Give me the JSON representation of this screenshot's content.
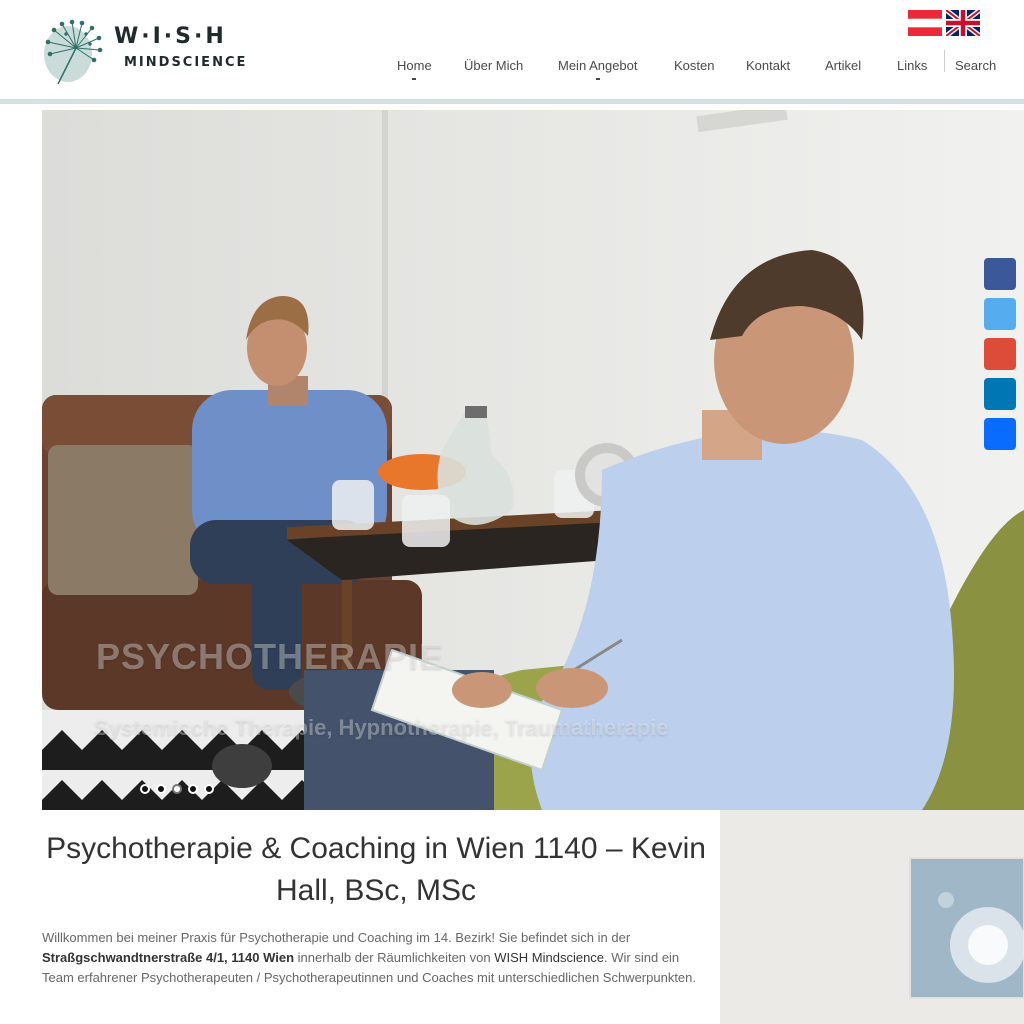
{
  "brand": {
    "name": "W·I·S·H",
    "tagline": "MINDSCIENCE"
  },
  "languages": [
    {
      "code": "de-AT",
      "icon": "austria-flag-icon"
    },
    {
      "code": "en-GB",
      "icon": "uk-flag-icon"
    }
  ],
  "nav": {
    "items": [
      {
        "label": "Home"
      },
      {
        "label": "Über Mich"
      },
      {
        "label": "Mein Angebot"
      },
      {
        "label": "Kosten"
      },
      {
        "label": "Kontakt"
      },
      {
        "label": "Artikel"
      },
      {
        "label": "Links"
      }
    ],
    "search_label": "Search"
  },
  "slider": {
    "title": "PSYCHOTHERAPIE",
    "subtitle": "Systemische Therapie, Hypnotherapie, Traumatherapie",
    "slide_count": 5,
    "active_slide": 3
  },
  "social": [
    {
      "icon": "facebook-icon",
      "color": "#3b5998"
    },
    {
      "icon": "twitter-icon",
      "color": "#55acee"
    },
    {
      "icon": "google-plus-icon",
      "color": "#dd4b39"
    },
    {
      "icon": "linkedin-icon",
      "color": "#0077b5"
    },
    {
      "icon": "share-icon",
      "color": "#0a6cff"
    }
  ],
  "main": {
    "heading": "Psychotherapie & Coaching in Wien 1140 – Kevin Hall, BSc, MSc",
    "intro_1": "Willkommen bei meiner Praxis für Psychotherapie und Coaching im 14. Bezirk! Sie befindet sich in der ",
    "intro_address": "Straßgschwandtnerstraße 4/1, 1140 Wien",
    "intro_2": " innerhalb der Räumlichkeiten von ",
    "intro_link": "WISH Mindscience",
    "intro_3": ". Wir sind ein Team erfahrener Psychotherapeuten / Psychotherapeutinnen und Coaches mit unterschiedlichen Schwerpunkten."
  },
  "colors": {
    "accent_rule": "#d5e1e0",
    "logo_dark": "#1f2a2c",
    "logo_teal": "#2f6f6a"
  }
}
